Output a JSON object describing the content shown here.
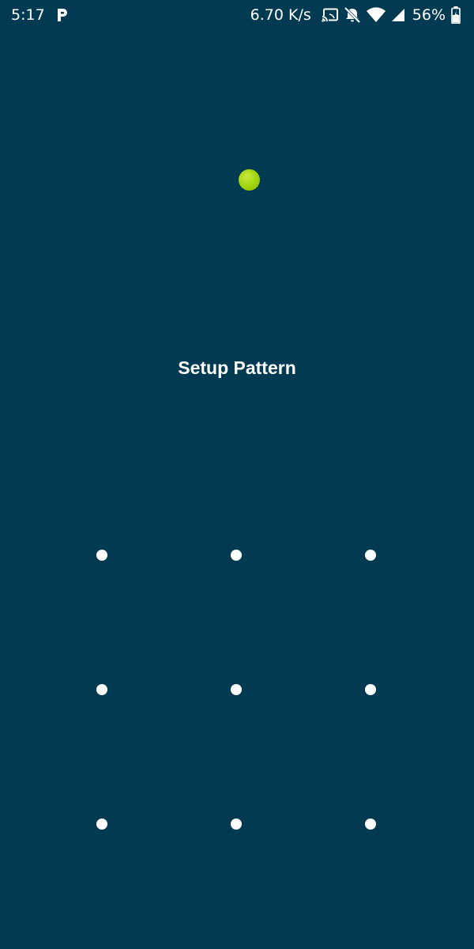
{
  "status_bar": {
    "time": "5:17",
    "net_speed": "6.70 K/s",
    "battery": "56%",
    "icons": [
      "parking-app-icon",
      "cast-icon",
      "notifications-off-icon",
      "wifi-icon",
      "signal-icon",
      "battery-icon"
    ]
  },
  "screen": {
    "title": "Setup Pattern"
  },
  "pattern": {
    "nodes": [
      "1",
      "2",
      "3",
      "4",
      "5",
      "6",
      "7",
      "8",
      "9"
    ]
  },
  "colors": {
    "background": "#023a51",
    "indicator": "#9bd108",
    "dot": "#ffffff"
  }
}
